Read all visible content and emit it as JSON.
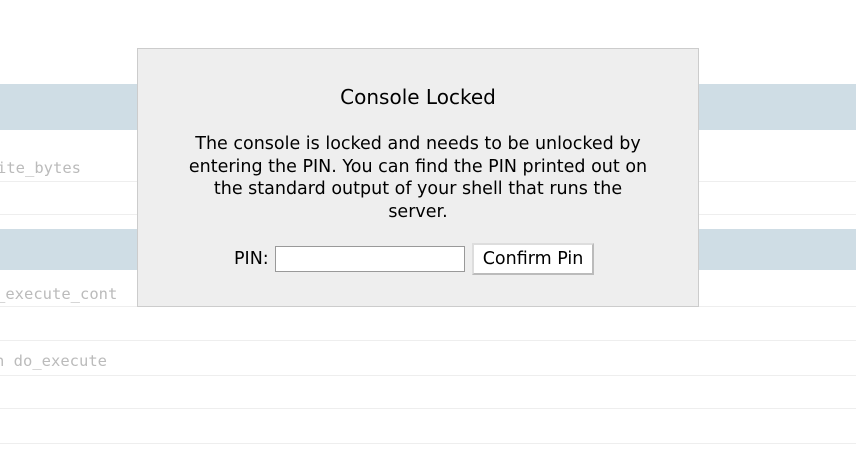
{
  "background": {
    "code_lines": [
      "ite_bytes",
      "_execute_cont",
      "n do_execute"
    ]
  },
  "modal": {
    "title": "Console Locked",
    "message": "The console is locked and needs to be unlocked by entering the PIN. You can find the PIN printed out on the standard output of your shell that runs the server.",
    "pin_label": "PIN:",
    "pin_value": "",
    "confirm_label": "Confirm Pin"
  },
  "colors": {
    "frame_band": "#cfdde5",
    "modal_background": "#eeeeee",
    "code_text": "#bbbbbb"
  }
}
